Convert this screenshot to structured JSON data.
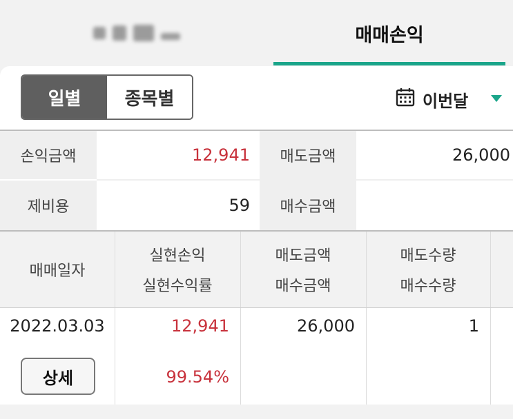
{
  "tabs": {
    "left_label": "",
    "right_label": "매매손익"
  },
  "filter": {
    "daily_label": "일별",
    "by_stock_label": "종목별",
    "period_label": "이번달"
  },
  "summary": {
    "profit_label": "손익금액",
    "profit_value": "12,941",
    "sell_amount_label": "매도금액",
    "sell_amount_value": "26,000",
    "fees_label": "제비용",
    "fees_value": "59",
    "buy_amount_label": "매수금액",
    "buy_amount_value": ""
  },
  "table": {
    "headers": {
      "date": "매매일자",
      "realized_pnl": "실현손익",
      "realized_rate": "실현수익률",
      "sell_amount": "매도금액",
      "buy_amount": "매수금액",
      "sell_qty": "매도수량",
      "buy_qty": "매수수량"
    },
    "rows": [
      {
        "date": "2022.03.03",
        "detail_label": "상세",
        "realized_pnl": "12,941",
        "realized_rate": "99.54%",
        "sell_amount": "26,000",
        "sell_qty": "1"
      }
    ]
  },
  "colors": {
    "accent": "#1aa58a",
    "profit_red": "#c8323c",
    "segment_active": "#5f5f5f"
  },
  "icons": {
    "calendar": "calendar-icon",
    "caret": "caret-down-icon"
  }
}
